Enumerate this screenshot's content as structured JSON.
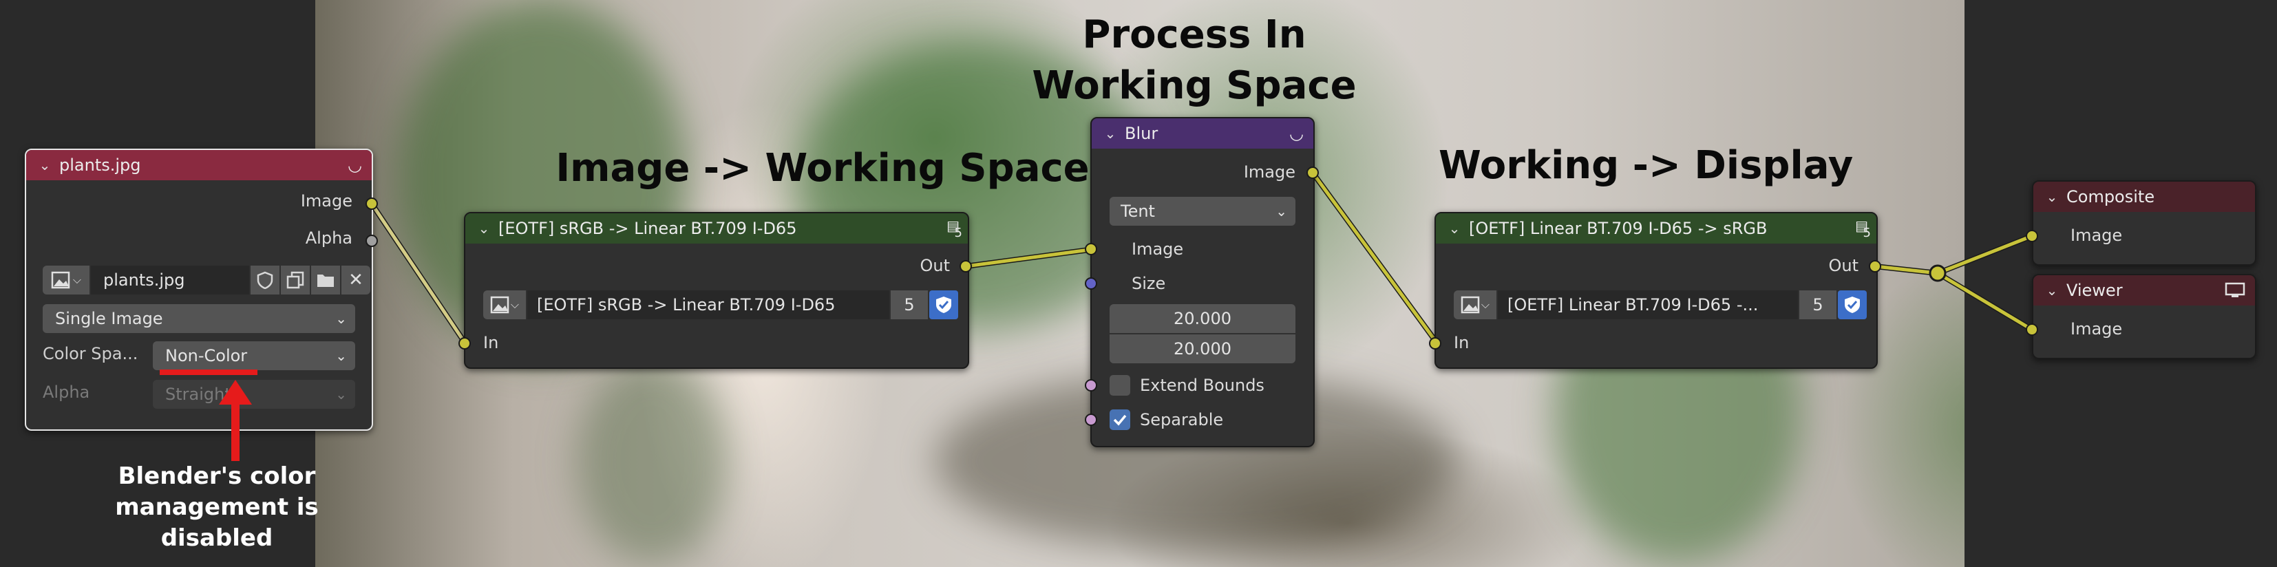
{
  "colors": {
    "socket_image": "#c8c33a",
    "socket_float": "#a0a0a0",
    "socket_vector": "#6363c7",
    "socket_bool": "#c89ad0",
    "header_image_node": "#8a2a40",
    "header_group_node": "#2f4d28",
    "header_filter_node": "#4a2f6e",
    "header_output_node": "#4a2229",
    "annotation_red": "#e61b1b",
    "title_text": "#0a0a0a",
    "annotation_text": "#ffffff"
  },
  "titles": {
    "image_to_working": "Image -> Working Space",
    "process_line1": "Process In",
    "process_line2": "Working Space",
    "working_to_display": "Working -> Display"
  },
  "annotation": {
    "line1": "Blender's color",
    "line2": "management is",
    "line3": "disabled"
  },
  "image_node": {
    "title": "plants.jpg",
    "out_image": "Image",
    "out_alpha": "Alpha",
    "image_name": "plants.jpg",
    "source": "Single Image",
    "colorspace_label": "Color Spa...",
    "colorspace_value": "Non-Color",
    "alpha_label": "Alpha",
    "alpha_value": "Straight",
    "icons": [
      "image-icon",
      "shield-icon",
      "duplicate-icon",
      "folder-icon",
      "close-icon"
    ]
  },
  "eotf_node": {
    "title": "[EOTF] sRGB -> Linear BT.709 I-D65",
    "users": "5",
    "out": "Out",
    "group_name": "[EOTF] sRGB -> Linear BT.709 I-D65",
    "count": "5",
    "in": "In"
  },
  "blur_node": {
    "title": "Blur",
    "out_image": "Image",
    "filter_type": "Tent",
    "in_image": "Image",
    "size_label": "Size",
    "size_x": "20.000",
    "size_y": "20.000",
    "extend_bounds": "Extend Bounds",
    "extend_bounds_checked": false,
    "separable": "Separable",
    "separable_checked": true
  },
  "oetf_node": {
    "title": "[OETF] Linear BT.709 I-D65 -> sRGB",
    "users": "5",
    "out": "Out",
    "group_name": "[OETF] Linear BT.709 I-D65 -...",
    "count": "5",
    "in": "In"
  },
  "composite_node": {
    "title": "Composite",
    "in_image": "Image"
  },
  "viewer_node": {
    "title": "Viewer",
    "in_image": "Image"
  }
}
